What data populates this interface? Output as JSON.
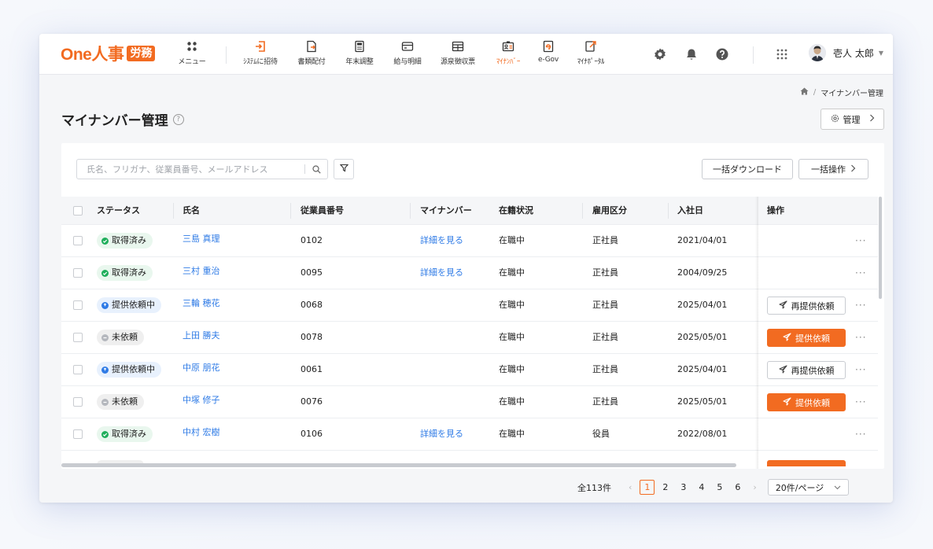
{
  "app": {
    "logo_text": "One人事",
    "logo_badge": "労務",
    "brand_color": "#f26b21"
  },
  "nav": [
    {
      "label": "メニュー",
      "icon": "grid-menu-icon",
      "active": false
    },
    {
      "label": "ｼｽﾃﾑに招待",
      "icon": "invite-icon",
      "active": false
    },
    {
      "label": "書類配付",
      "icon": "document-send-icon",
      "active": false
    },
    {
      "label": "年末調整",
      "icon": "calculator-icon",
      "active": false
    },
    {
      "label": "給与明細",
      "icon": "payslip-icon",
      "active": false
    },
    {
      "label": "源泉徴収票",
      "icon": "withholding-icon",
      "active": false
    },
    {
      "label": "ﾏｲﾅﾝﾊﾞｰ",
      "icon": "mynumber-card-icon",
      "active": true
    },
    {
      "label": "e-Gov",
      "icon": "egov-icon",
      "active": false
    },
    {
      "label": "ﾏｲﾅﾎﾟｰﾀﾙ",
      "icon": "mynaportal-icon",
      "active": false
    }
  ],
  "header_icons": [
    "gear-icon",
    "bell-icon",
    "help-icon",
    "apps-grid-icon"
  ],
  "user": {
    "name": "壱人 太郎"
  },
  "breadcrumb": {
    "current": "マイナンバー管理"
  },
  "page": {
    "title": "マイナンバー管理",
    "manage_label": "管理"
  },
  "toolbar": {
    "search_placeholder": "氏名、フリガナ、従業員番号、メールアドレス",
    "bulk_download": "一括ダウンロード",
    "bulk_operation": "一括操作"
  },
  "table": {
    "headers": {
      "status": "ステータス",
      "name": "氏名",
      "employee_no": "従業員番号",
      "mynumber": "マイナンバー",
      "enrollment": "在籍状況",
      "employment": "雇用区分",
      "joined": "入社日",
      "ops": "操作"
    },
    "rows": [
      {
        "status": "取得済み",
        "status_kind": "done",
        "name": "三島 真理",
        "no": "0102",
        "mynumber": "詳細を見る",
        "enrollment": "在職中",
        "employment": "正社員",
        "joined": "2021/04/01",
        "action": ""
      },
      {
        "status": "取得済み",
        "status_kind": "done",
        "name": "三村 重治",
        "no": "0095",
        "mynumber": "詳細を見る",
        "enrollment": "在職中",
        "employment": "正社員",
        "joined": "2004/09/25",
        "action": ""
      },
      {
        "status": "提供依頼中",
        "status_kind": "req",
        "name": "三輪 穂花",
        "no": "0068",
        "mynumber": "",
        "enrollment": "在職中",
        "employment": "正社員",
        "joined": "2025/04/01",
        "action": "再提供依頼"
      },
      {
        "status": "未依頼",
        "status_kind": "none",
        "name": "上田 勝夫",
        "no": "0078",
        "mynumber": "",
        "enrollment": "在職中",
        "employment": "正社員",
        "joined": "2025/05/01",
        "action": "提供依頼"
      },
      {
        "status": "提供依頼中",
        "status_kind": "req",
        "name": "中原 朋花",
        "no": "0061",
        "mynumber": "",
        "enrollment": "在職中",
        "employment": "正社員",
        "joined": "2025/04/01",
        "action": "再提供依頼"
      },
      {
        "status": "未依頼",
        "status_kind": "none",
        "name": "中塚 修子",
        "no": "0076",
        "mynumber": "",
        "enrollment": "在職中",
        "employment": "正社員",
        "joined": "2025/05/01",
        "action": "提供依頼"
      },
      {
        "status": "取得済み",
        "status_kind": "done",
        "name": "中村 宏樹",
        "no": "0106",
        "mynumber": "詳細を見る",
        "enrollment": "在職中",
        "employment": "役員",
        "joined": "2022/08/01",
        "action": ""
      }
    ]
  },
  "pagination": {
    "total": "全113件",
    "pages": [
      "1",
      "2",
      "3",
      "4",
      "5",
      "6"
    ],
    "current": "1",
    "page_size": "20件/ページ"
  }
}
